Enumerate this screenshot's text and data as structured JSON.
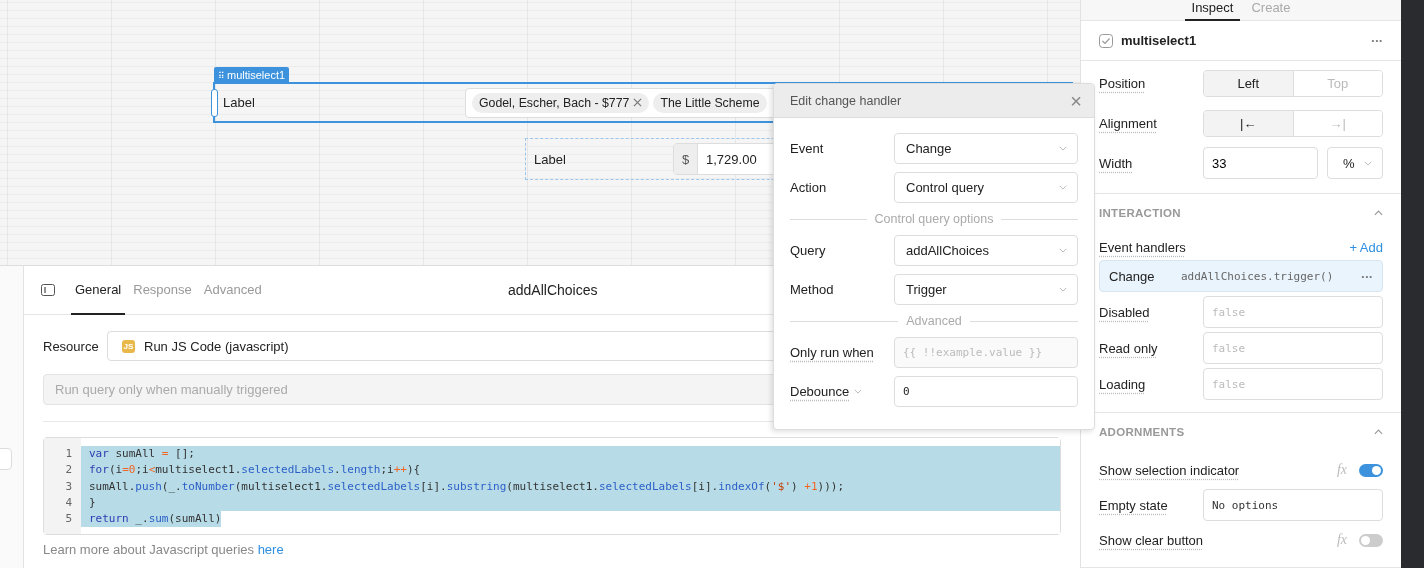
{
  "canvas": {
    "multiselect": {
      "tag": "multiselect1",
      "label": "Label",
      "grip": "⠿",
      "chips": [
        {
          "text": "Godel, Escher, Bach - $777",
          "removable": true
        },
        {
          "text": "The Little Scheme",
          "removable": false
        }
      ]
    },
    "currency_input": {
      "label": "Label",
      "prefix": "$",
      "value": "1,729.00"
    }
  },
  "query_editor": {
    "tabs": [
      {
        "label": "General",
        "selected": true
      },
      {
        "label": "Response",
        "selected": false
      },
      {
        "label": "Advanced",
        "selected": false
      }
    ],
    "title": "addAllChoices",
    "resource": {
      "label": "Resource",
      "badge": "JS",
      "value": "Run JS Code (javascript)"
    },
    "trigger": {
      "placeholder": "Run query only when manually triggered"
    },
    "code": [
      {
        "number": "1",
        "selected": true,
        "tokens": [
          {
            "kind": "keyword",
            "text": "var"
          },
          {
            "kind": "plain",
            "text": " sumAll "
          },
          {
            "kind": "operator",
            "text": "="
          },
          {
            "kind": "plain",
            "text": " [];"
          }
        ]
      },
      {
        "number": "2",
        "selected": true,
        "tokens": [
          {
            "kind": "keyword",
            "text": "for"
          },
          {
            "kind": "plain",
            "text": "(i"
          },
          {
            "kind": "operator",
            "text": "="
          },
          {
            "kind": "number",
            "text": "0"
          },
          {
            "kind": "plain",
            "text": ";i"
          },
          {
            "kind": "operator",
            "text": "<"
          },
          {
            "kind": "plain",
            "text": "multiselect1."
          },
          {
            "kind": "property",
            "text": "selectedLabels"
          },
          {
            "kind": "plain",
            "text": "."
          },
          {
            "kind": "property",
            "text": "length"
          },
          {
            "kind": "plain",
            "text": ";i"
          },
          {
            "kind": "operator",
            "text": "++"
          },
          {
            "kind": "plain",
            "text": "){"
          }
        ]
      },
      {
        "number": "3",
        "selected": true,
        "tokens": [
          {
            "kind": "plain",
            "text": "sumAll."
          },
          {
            "kind": "property",
            "text": "push"
          },
          {
            "kind": "plain",
            "text": "(_."
          },
          {
            "kind": "property",
            "text": "toNumber"
          },
          {
            "kind": "plain",
            "text": "(multiselect1."
          },
          {
            "kind": "property",
            "text": "selectedLabels"
          },
          {
            "kind": "plain",
            "text": "[i]."
          },
          {
            "kind": "property",
            "text": "substring"
          },
          {
            "kind": "plain",
            "text": "(multiselect1."
          },
          {
            "kind": "property",
            "text": "selectedLabels"
          },
          {
            "kind": "plain",
            "text": "[i]."
          },
          {
            "kind": "property",
            "text": "indexOf"
          },
          {
            "kind": "plain",
            "text": "("
          },
          {
            "kind": "string",
            "text": "'$'"
          },
          {
            "kind": "plain",
            "text": ") "
          },
          {
            "kind": "operator",
            "text": "+"
          },
          {
            "kind": "number",
            "text": "1"
          },
          {
            "kind": "plain",
            "text": ")));"
          }
        ]
      },
      {
        "number": "4",
        "selected": true,
        "tokens": [
          {
            "kind": "plain",
            "text": "}"
          }
        ]
      },
      {
        "number": "5",
        "selected": true,
        "tokens": [
          {
            "kind": "keyword",
            "text": "return"
          },
          {
            "kind": "plain",
            "text": " _."
          },
          {
            "kind": "property",
            "text": "sum"
          },
          {
            "kind": "plain",
            "text": "(sumAll)"
          }
        ]
      }
    ],
    "footer": {
      "text": "Learn more about Javascript queries",
      "link": "here"
    }
  },
  "dialog": {
    "title": "Edit change handler",
    "close": "×",
    "sections": [
      {
        "rows": [
          {
            "label": "Event",
            "kind": "select",
            "value": "Change"
          },
          {
            "label": "Action",
            "kind": "select",
            "value": "Control query"
          }
        ]
      },
      {
        "heading": "Control query options",
        "rows": [
          {
            "label": "Query",
            "kind": "select",
            "value": "addAllChoices"
          },
          {
            "label": "Method",
            "kind": "select",
            "value": "Trigger"
          }
        ]
      },
      {
        "heading": "Advanced",
        "rows": [
          {
            "label": "Only run when",
            "kind": "code",
            "placeholder": "{{ !!example.value }}"
          },
          {
            "label": "Debounce",
            "kind": "number",
            "value": "0",
            "caret": true
          }
        ]
      }
    ]
  },
  "inspector": {
    "tabs": [
      {
        "label": "Inspect",
        "selected": true
      },
      {
        "label": "Create",
        "selected": false
      }
    ],
    "component": "multiselect1",
    "more": "•••",
    "layout": [
      {
        "label": "Position",
        "kind": "segmented",
        "options": [
          {
            "text": "Left",
            "selected": true
          },
          {
            "text": "Top",
            "selected": false
          }
        ]
      },
      {
        "label": "Alignment",
        "kind": "segmented",
        "options": [
          {
            "text": "|←",
            "selected": true
          },
          {
            "text": "→|",
            "selected": false
          }
        ]
      },
      {
        "label": "Width",
        "kind": "width",
        "value": "33",
        "unit": "%"
      }
    ],
    "sections": [
      {
        "title": "INTERACTION",
        "expanded": true,
        "handlers": {
          "label": "Event handlers",
          "add": "+ Add",
          "items": [
            {
              "event": "Change",
              "action": "addAllChoices.trigger()",
              "more": "•••"
            }
          ]
        },
        "rows": [
          {
            "label": "Disabled",
            "kind": "field",
            "placeholder": "false"
          },
          {
            "label": "Read only",
            "kind": "field",
            "placeholder": "false"
          },
          {
            "label": "Loading",
            "kind": "field",
            "placeholder": "false"
          }
        ]
      },
      {
        "title": "ADORNMENTS",
        "expanded": true,
        "rows": [
          {
            "label": "Show selection indicator",
            "kind": "toggle",
            "fx": "fx",
            "on": true
          },
          {
            "label": "Empty state",
            "kind": "field",
            "value": "No options"
          },
          {
            "label": "Show clear button",
            "kind": "toggle",
            "fx": "fx",
            "on": false
          }
        ]
      }
    ]
  }
}
